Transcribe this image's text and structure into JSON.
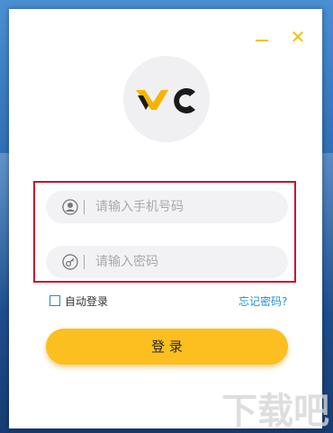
{
  "window": {
    "minimize_label": "_",
    "close_label": "✕"
  },
  "logo": {
    "text": "YC",
    "accent_color": "#f5b400",
    "dark_color": "#1a1a1a"
  },
  "form": {
    "phone_placeholder": "请输入手机号码",
    "password_placeholder": "请输入密码",
    "auto_login_label": "自动登录",
    "auto_login_checked": false,
    "forgot_password_label": "忘记密码?",
    "login_button_label": "登 录"
  },
  "colors": {
    "accent": "#fbbf1f",
    "link": "#1d8fd6",
    "highlight_border": "#c8102e"
  },
  "watermark": {
    "text": "下载吧"
  }
}
